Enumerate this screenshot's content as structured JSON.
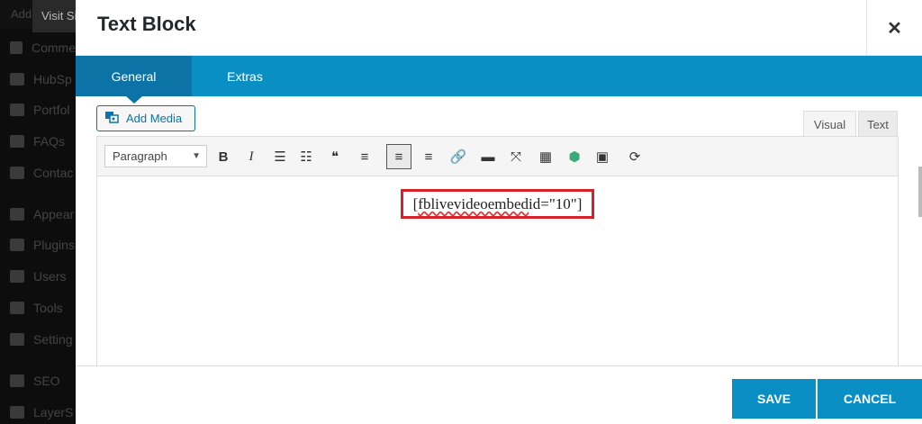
{
  "background": {
    "admin_bar_add": "Add",
    "visit_site": "Visit Si",
    "menu": [
      {
        "label": "Comme",
        "icon": "comments-icon"
      },
      {
        "label": "HubSp",
        "icon": "hubspot-icon"
      },
      {
        "label": "Portfol",
        "icon": "pin-icon"
      },
      {
        "label": "FAQs",
        "icon": "pin-icon"
      },
      {
        "label": "Contac",
        "icon": "mail-icon"
      },
      {
        "label": "Appear",
        "icon": "brush-icon"
      },
      {
        "label": "Plugins",
        "icon": "plugin-icon"
      },
      {
        "label": "Users",
        "icon": "user-icon"
      },
      {
        "label": "Tools",
        "icon": "wrench-icon"
      },
      {
        "label": "Setting",
        "icon": "settings-icon"
      },
      {
        "label": "SEO",
        "icon": "yoast-icon"
      },
      {
        "label": "LayerS",
        "icon": "layers-icon"
      }
    ]
  },
  "modal": {
    "title": "Text Block",
    "close_glyph": "✕",
    "tabs": [
      {
        "label": "General",
        "active": true
      },
      {
        "label": "Extras",
        "active": false
      }
    ],
    "add_media_label": "Add Media",
    "mode_tabs": {
      "visual": "Visual",
      "text": "Text"
    },
    "format_select_value": "Paragraph",
    "toolbar_buttons": [
      {
        "name": "bold-button",
        "glyph": "B"
      },
      {
        "name": "italic-button",
        "glyph": "I"
      },
      {
        "name": "bullet-list-button",
        "glyph": "☰"
      },
      {
        "name": "numbered-list-button",
        "glyph": "☷"
      },
      {
        "name": "blockquote-button",
        "glyph": "❝"
      },
      {
        "name": "align-left-button",
        "glyph": "≡"
      },
      {
        "name": "align-center-button",
        "glyph": "≡",
        "active": true
      },
      {
        "name": "align-right-button",
        "glyph": "≡"
      },
      {
        "name": "insert-link-button",
        "glyph": "🔗"
      },
      {
        "name": "read-more-button",
        "glyph": "▬"
      },
      {
        "name": "fullscreen-button",
        "glyph": "⤧"
      },
      {
        "name": "toolbar-toggle-button",
        "glyph": "▦"
      },
      {
        "name": "shortcode-generator-button",
        "glyph": "⬢"
      },
      {
        "name": "insert-gallery-button",
        "glyph": "▣"
      },
      {
        "name": "refresh-button",
        "glyph": "⟳"
      }
    ],
    "content": {
      "shortcode_prefix": "[",
      "shortcode_name": "fblivevideoembed",
      "shortcode_rest": " id=\"10\"]"
    },
    "footer": {
      "save_label": "SAVE",
      "cancel_label": "CANCEL"
    },
    "accent_color": "#0a8fc4",
    "active_tab_color": "#0b73a5",
    "highlight_color": "#d6202a"
  }
}
